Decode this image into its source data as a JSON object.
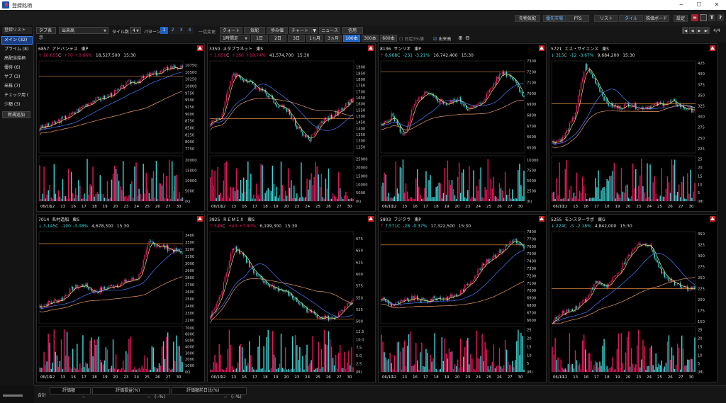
{
  "window": {
    "title": "登録銘柄",
    "controls": [
      "─",
      "☐",
      "✕"
    ]
  },
  "topbar": {
    "buttons": [
      {
        "label": "先物気配"
      },
      {
        "label": "優先市場"
      },
      {
        "label": "PTS"
      },
      {
        "label": "リスト"
      },
      {
        "label": "タイル"
      },
      {
        "label": "株価ボード"
      },
      {
        "label": "設定"
      }
    ],
    "right_icons": [
      "link-icon",
      "window-icon",
      "text-icon",
      "help-icon"
    ],
    "help_glyph": "?",
    "text_glyph": "T"
  },
  "toolbar": {
    "tab_display": "タブ表示",
    "sort_select": "出来高",
    "tile_label": "タイル数",
    "tile_count": "4",
    "pattern_label": "パターン",
    "patterns": [
      "1",
      "2",
      "3",
      "4"
    ],
    "batch_label": "一括変更",
    "view_tabs": [
      {
        "label": "クォート"
      },
      {
        "label": "気配"
      },
      {
        "label": "歩み値"
      },
      {
        "label": "チャート"
      },
      {
        "label": "▼"
      },
      {
        "label": "ニュース"
      },
      {
        "label": "信用"
      }
    ],
    "interval_select": "1時間足",
    "periods": [
      "1日",
      "2日",
      "3日",
      "1ヵ月",
      "3ヵ月",
      "100本",
      "300本",
      "600本"
    ],
    "active_period": "100本",
    "checkbox_hourly3": "日足3%値",
    "checkbox_volume": "出来高",
    "page_indicator": "4/4",
    "nav": [
      "|◀",
      "◀",
      "▶",
      "▶|"
    ]
  },
  "sidebar": {
    "header": "登録リスト",
    "items": [
      {
        "label": "メイン (32)"
      },
      {
        "label": "プライム (8)"
      },
      {
        "label": "高配当銘柄"
      },
      {
        "label": "優待 (6)"
      },
      {
        "label": "サブ (3)"
      },
      {
        "label": "米株 (7)"
      },
      {
        "label": "チェック用 ("
      },
      {
        "label": "少額 (3)"
      }
    ],
    "add_button": "新規追加"
  },
  "x_labels": [
    "06/10",
    "12",
    "13",
    "16",
    "17",
    "18",
    "19",
    "20",
    "23",
    "24",
    "25",
    "26",
    "27",
    "30"
  ],
  "colors": {
    "up": "#e0195a",
    "down": "#3fd6d6",
    "ma_short": "#e8e070",
    "ma_mid": "#4a7dff",
    "ma_long": "#e89a6a",
    "hline": "#d88a3a"
  },
  "chart_data": [
    {
      "type": "line",
      "code": "6857",
      "name": "アドバンテス",
      "market": "東P",
      "dir": "↑",
      "price": "10,655",
      "suffix": "C",
      "change": "+70",
      "pct": "+0.66%",
      "volume": "18,527,500",
      "time": "15:30",
      "trend": "up",
      "x": [
        "06/10",
        "12",
        "13",
        "16",
        "17",
        "18",
        "19",
        "20",
        "23",
        "24",
        "25",
        "26",
        "27",
        "30"
      ],
      "close": [
        8500,
        8600,
        8800,
        9000,
        9300,
        9500,
        9600,
        9800,
        10100,
        10200,
        10400,
        10500,
        10700,
        10655
      ],
      "ylim": [
        7600,
        10900
      ],
      "yticks": [
        "10750",
        "10500",
        "10250",
        "10000",
        "9750",
        "9500",
        "9250",
        "9000",
        "8750",
        "8500",
        "8250",
        "8000",
        "7750"
      ],
      "hline": 10350,
      "vol_ticks": [
        "20000",
        "15000",
        "10000",
        "5000"
      ],
      "vol_unit": "(K)",
      "vol_max": 22000
    },
    {
      "type": "line",
      "code": "3350",
      "name": "メタプラネット",
      "market": "東S",
      "dir": "↑",
      "price": "1,650",
      "suffix": "C",
      "change": "+160",
      "pct": "+10.74%",
      "volume": "41,574,700",
      "time": "15:30",
      "trend": "volatile",
      "x": [
        "06/10",
        "12",
        "13",
        "16",
        "17",
        "18",
        "19",
        "20",
        "23",
        "24",
        "25",
        "26",
        "27",
        "30"
      ],
      "close": [
        1450,
        1500,
        1850,
        1800,
        1750,
        1700,
        1600,
        1550,
        1400,
        1300,
        1450,
        1500,
        1550,
        1650
      ],
      "ylim": [
        1200,
        1950
      ],
      "yticks": [
        "1900",
        "1850",
        "1800",
        "1750",
        "1700",
        "1650",
        "1600",
        "1550",
        "1500",
        "1450",
        "1400",
        "1350",
        "1300",
        "1250"
      ],
      "hline": 1480,
      "vol_ticks": [
        "25000",
        "20000",
        "15000",
        "10000",
        "5000"
      ],
      "vol_unit": "(K)",
      "vol_max": 27000
    },
    {
      "type": "line",
      "code": "8136",
      "name": "サンリオ",
      "market": "東P",
      "dir": "↑",
      "price": "6,968",
      "suffix": "C",
      "change": "-231",
      "pct": "-3.21%",
      "volume": "16,742,400",
      "time": "15:30",
      "trend": "upvol",
      "x": [
        "06/10",
        "12",
        "13",
        "16",
        "17",
        "18",
        "19",
        "20",
        "23",
        "24",
        "25",
        "26",
        "27",
        "30"
      ],
      "close": [
        6700,
        6800,
        6600,
        6900,
        7000,
        6950,
        6900,
        6950,
        6850,
        6900,
        7050,
        7200,
        7150,
        6968
      ],
      "ylim": [
        6450,
        7300
      ],
      "yticks": [
        "7300",
        "7200",
        "7100",
        "7000",
        "6900",
        "6800",
        "6700",
        "6600",
        "6500"
      ],
      "hline": 7200,
      "vol_ticks": [
        "10000",
        "7500",
        "5000",
        "2500"
      ],
      "vol_unit": "(K)",
      "vol_max": 11000
    },
    {
      "type": "line",
      "code": "5721",
      "name": "エス・サイエンス",
      "market": "東S",
      "dir": "↓",
      "price": "315",
      "suffix": "C",
      "change": "-12",
      "pct": "-3.67%",
      "volume": "9,684,200",
      "time": "15:30",
      "trend": "spike",
      "x": [
        "06/10",
        "12",
        "13",
        "16",
        "17",
        "18",
        "19",
        "20",
        "23",
        "24",
        "25",
        "26",
        "27",
        "30"
      ],
      "close": [
        240,
        250,
        300,
        420,
        380,
        330,
        320,
        330,
        320,
        325,
        330,
        335,
        320,
        315
      ],
      "ylim": [
        215,
        430
      ],
      "yticks": [
        "425",
        "400",
        "375",
        "350",
        "325",
        "300",
        "275",
        "250",
        "225"
      ],
      "hline": 330,
      "vol_ticks": [
        "25",
        "20",
        "15",
        "10",
        "5"
      ],
      "vol_unit": "(M)",
      "vol_max": 27
    },
    {
      "type": "line",
      "code": "7014",
      "name": "名村造船",
      "market": "東S",
      "dir": "↓",
      "price": "3,145",
      "suffix": "C",
      "change": "-100",
      "pct": "-3.08%",
      "volume": "4,678,300",
      "time": "15:30",
      "trend": "up",
      "x": [
        "06/10",
        "12",
        "13",
        "16",
        "17",
        "18",
        "19",
        "20",
        "23",
        "24",
        "25",
        "26",
        "27",
        "30"
      ],
      "close": [
        2400,
        2450,
        2500,
        2650,
        2700,
        2600,
        2650,
        2700,
        2750,
        2800,
        3300,
        3250,
        3200,
        3145
      ],
      "ylim": [
        2150,
        3450
      ],
      "yticks": [
        "3400",
        "3300",
        "3200",
        "3100",
        "3000",
        "2900",
        "2800",
        "2700",
        "2600",
        "2500",
        "2400",
        "2300",
        "2200"
      ],
      "hline": 3280,
      "vol_ticks": [
        "7000",
        "6000",
        "5000",
        "4000",
        "3000",
        "2000",
        "1000"
      ],
      "vol_unit": "(K)",
      "vol_max": 7200
    },
    {
      "type": "line",
      "code": "3825",
      "name": "ＲＥＭＩＸ",
      "market": "東S",
      "dir": "↑",
      "price": "546",
      "suffix": "C",
      "change": "+40",
      "pct": "+7.90%",
      "volume": "6,199,300",
      "time": "15:30",
      "trend": "peakdown",
      "x": [
        "06/10",
        "12",
        "13",
        "16",
        "17",
        "18",
        "19",
        "20",
        "23",
        "24",
        "25",
        "26",
        "27",
        "30"
      ],
      "close": [
        510,
        560,
        660,
        640,
        600,
        580,
        570,
        560,
        540,
        520,
        510,
        505,
        520,
        546
      ],
      "ylim": [
        495,
        690
      ],
      "yticks": [
        "675",
        "650",
        "625",
        "600",
        "575",
        "550",
        "525",
        "500"
      ],
      "hline": 505,
      "vol_ticks": [
        "12.5",
        "10.0",
        "7.5",
        "5.0",
        "2.5"
      ],
      "vol_unit": "(M)",
      "vol_max": 14
    },
    {
      "type": "line",
      "code": "5803",
      "name": "フジクラ",
      "market": "東P",
      "dir": "↑",
      "price": "7,571",
      "suffix": "C",
      "change": "-28",
      "pct": "-0.37%",
      "volume": "17,322,500",
      "time": "15:30",
      "trend": "lateup",
      "x": [
        "06/10",
        "12",
        "13",
        "16",
        "17",
        "18",
        "19",
        "20",
        "23",
        "24",
        "25",
        "26",
        "27",
        "30"
      ],
      "close": [
        6900,
        6800,
        6850,
        6900,
        6850,
        6900,
        6900,
        6950,
        7100,
        7300,
        7450,
        7550,
        7700,
        7571
      ],
      "ylim": [
        6550,
        7800
      ],
      "yticks": [
        "7800",
        "7700",
        "7600",
        "7500",
        "7400",
        "7300",
        "7200",
        "7100",
        "7000",
        "6900",
        "6800",
        "6700",
        "6600"
      ],
      "hline": 7620,
      "vol_ticks": [
        "25",
        "20",
        "15",
        "10",
        "5"
      ],
      "vol_unit": "(M)",
      "vol_max": 27
    },
    {
      "type": "line",
      "code": "5255",
      "name": "モンスターラボ",
      "market": "東G",
      "dir": "↓",
      "price": "224",
      "suffix": "C",
      "change": "-5",
      "pct": "-2.18%",
      "volume": "4,842,000",
      "time": "15:30",
      "trend": "humpdown",
      "x": [
        "06/10",
        "12",
        "13",
        "16",
        "17",
        "18",
        "19",
        "20",
        "23",
        "24",
        "25",
        "26",
        "27",
        "30"
      ],
      "close": [
        150,
        170,
        180,
        200,
        240,
        230,
        260,
        300,
        330,
        320,
        260,
        240,
        230,
        224
      ],
      "ylim": [
        145,
        355
      ],
      "yticks": [
        "350",
        "325",
        "300",
        "275",
        "250",
        "225",
        "200",
        "175",
        "150"
      ],
      "hline": 225,
      "vol_ticks": [
        "25",
        "20",
        "15",
        "10",
        "5"
      ],
      "vol_unit": "(M)",
      "vol_max": 27
    }
  ],
  "footer": {
    "total": "合計",
    "valuation": "評価額",
    "gain_label": "評価損益(%)",
    "day_label": "評価額前日比(%)",
    "valuation_value": "--",
    "gain_value": "--",
    "gain_pct": "(--%)",
    "day_value": "--",
    "day_pct": "(--%)"
  }
}
